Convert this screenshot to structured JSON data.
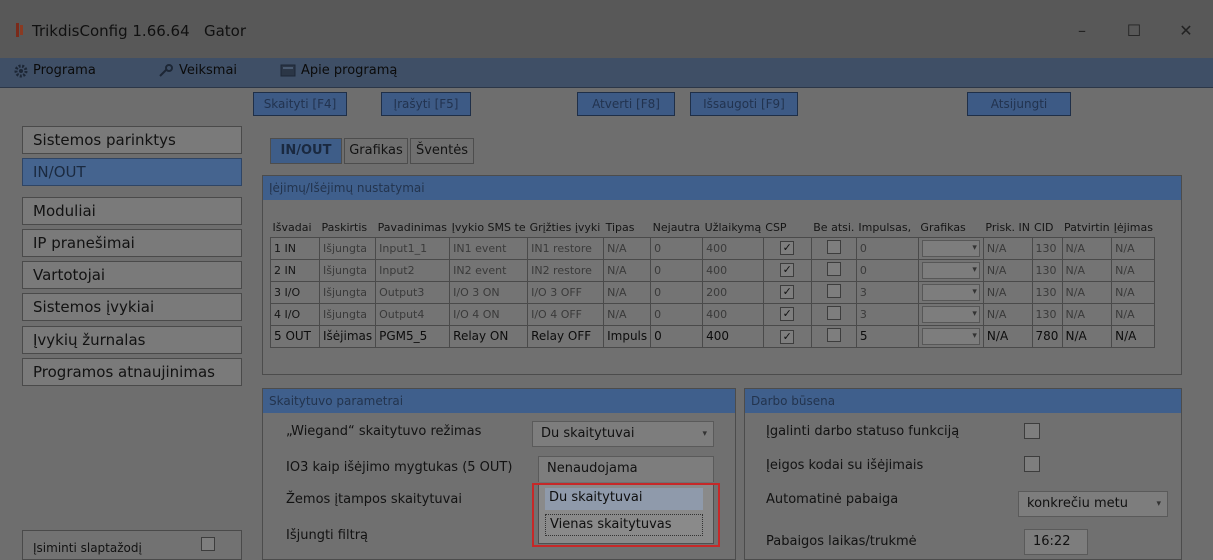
{
  "window": {
    "title": "TrikdisConfig 1.66.64",
    "device": "Gator",
    "minimize": "–",
    "maximize": "☐",
    "close": "✕"
  },
  "menu": [
    "Programa",
    "Veiksmai",
    "Apie programą"
  ],
  "toolbar": {
    "read": "Skaityti [F4]",
    "write": "Įrašyti [F5]",
    "open": "Atverti [F8]",
    "save": "Išsaugoti [F9]",
    "disconnect": "Atsijungti"
  },
  "sidebar": {
    "items": [
      "Sistemos parinktys",
      "IN/OUT",
      "Moduliai",
      "IP pranešimai",
      "Vartotojai",
      "Sistemos įvykiai",
      "Įvykių žurnalas",
      "Programos atnaujinimas"
    ],
    "active_index": 1,
    "remember_password": "Įsiminti slaptažodį"
  },
  "tabs": [
    "IN/OUT",
    "Grafikas",
    "Šventės"
  ],
  "io_panel": {
    "title": "Įėjimų/Išėjimų nustatymai",
    "headers": [
      "Išvadai",
      "Paskirtis",
      "Pavadinimas",
      "Įvykio SMS te",
      "Grįžties įvyki",
      "Tipas",
      "Nejautra",
      "Užlaikymą",
      "CSP",
      "Be atsi.",
      "Impulsas,",
      "Grafikas",
      "Prisk. IN",
      "CID",
      "Patvirtin",
      "Įėjimas"
    ],
    "rows": [
      {
        "pin": "1 IN",
        "purpose": "Išjungta",
        "name": "Input1_1",
        "sms": "IN1 event",
        "restore": "IN1 restore",
        "type": "N/A",
        "sens": "0",
        "delay": "400",
        "csp": true,
        "noack": false,
        "impulse": "0",
        "prisk": "N/A",
        "cid": "130",
        "confirm": "N/A",
        "input": "N/A",
        "bold": false
      },
      {
        "pin": "2 IN",
        "purpose": "Išjungta",
        "name": "Input2",
        "sms": "IN2 event",
        "restore": "IN2 restore",
        "type": "N/A",
        "sens": "0",
        "delay": "400",
        "csp": true,
        "noack": false,
        "impulse": "0",
        "prisk": "N/A",
        "cid": "130",
        "confirm": "N/A",
        "input": "N/A",
        "bold": false
      },
      {
        "pin": "3 I/O",
        "purpose": "Išjungta",
        "name": "Output3",
        "sms": "I/O 3 ON",
        "restore": "I/O 3 OFF",
        "type": "N/A",
        "sens": "0",
        "delay": "200",
        "csp": true,
        "noack": false,
        "impulse": "3",
        "prisk": "N/A",
        "cid": "130",
        "confirm": "N/A",
        "input": "N/A",
        "bold": false
      },
      {
        "pin": "4 I/O",
        "purpose": "Išjungta",
        "name": "Output4",
        "sms": "I/O 4 ON",
        "restore": "I/O 4 OFF",
        "type": "N/A",
        "sens": "0",
        "delay": "400",
        "csp": true,
        "noack": false,
        "impulse": "3",
        "prisk": "N/A",
        "cid": "130",
        "confirm": "N/A",
        "input": "N/A",
        "bold": false
      },
      {
        "pin": "5 OUT",
        "purpose": "Išėjimas",
        "name": "PGM5_5",
        "sms": "Relay ON",
        "restore": "Relay OFF",
        "type": "Impuls",
        "sens": "0",
        "delay": "400",
        "csp": true,
        "noack": false,
        "impulse": "5",
        "prisk": "N/A",
        "cid": "780",
        "confirm": "N/A",
        "input": "N/A",
        "bold": true
      }
    ]
  },
  "reader_panel": {
    "title": "Skaitytuvo parametrai",
    "wiegand_label": "„Wiegand“ skaitytuvo režimas",
    "wiegand_value": "Du skaitytuvai",
    "io3_label": "IO3 kaip išėjimo mygtukas (5 OUT)",
    "io3_value": "Nenaudojama",
    "lowvolt_label": "Žemos įtampos skaitytuvai",
    "filter_label": "Išjungti filtrą",
    "dropdown_options": [
      "Du skaitytuvai",
      "Vienas skaitytuvas"
    ]
  },
  "status_panel": {
    "title": "Darbo būsena",
    "enable_label": "Įgalinti darbo statuso funkciją",
    "codes_label": "Įeigos kodai su išėjimais",
    "auto_end_label": "Automatinė pabaiga",
    "auto_end_value": "konkrečiu metu",
    "end_time_label": "Pabaigos laikas/trukmė",
    "end_time_value": "16:22"
  },
  "colors": {
    "accent_blue": "#3e5d88",
    "highlight_red": "#c62828"
  }
}
